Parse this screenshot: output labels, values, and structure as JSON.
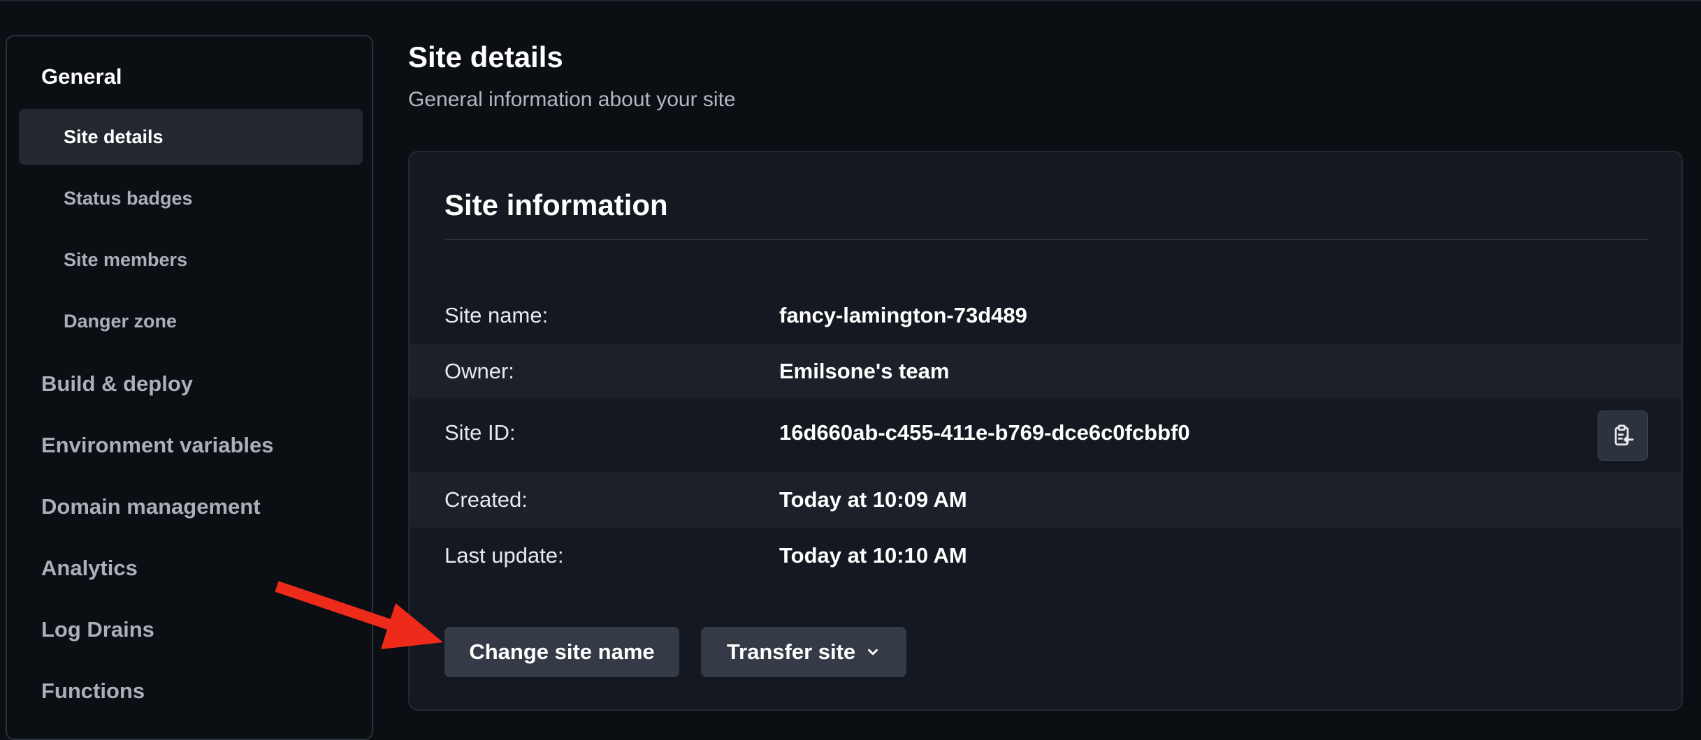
{
  "sidebar": {
    "group_title": "General",
    "sub_items": [
      {
        "label": "Site details",
        "active": true
      },
      {
        "label": "Status badges",
        "active": false
      },
      {
        "label": "Site members",
        "active": false
      },
      {
        "label": "Danger zone",
        "active": false
      }
    ],
    "main_items": [
      {
        "label": "Build & deploy"
      },
      {
        "label": "Environment variables"
      },
      {
        "label": "Domain management"
      },
      {
        "label": "Analytics"
      },
      {
        "label": "Log Drains"
      },
      {
        "label": "Functions"
      }
    ]
  },
  "header": {
    "title": "Site details",
    "subtitle": "General information about your site"
  },
  "card": {
    "title": "Site information",
    "rows": [
      {
        "label": "Site name:",
        "value": "fancy-lamington-73d489"
      },
      {
        "label": "Owner:",
        "value": "Emilsone's team"
      },
      {
        "label": "Site ID:",
        "value": "16d660ab-c455-411e-b769-dce6c0fcbbf0",
        "copy_icon": "clipboard-copy-icon"
      },
      {
        "label": "Created:",
        "value": "Today at 10:09 AM"
      },
      {
        "label": "Last update:",
        "value": "Today at 10:10 AM"
      }
    ],
    "buttons": {
      "change_name": "Change site name",
      "transfer": "Transfer site",
      "transfer_icon": "chevron-down-icon"
    }
  },
  "annotation": {
    "arrow_color": "#ee2a1b",
    "arrow_icon": "red-arrow-annotation"
  },
  "colors": {
    "background": "#0b0e13",
    "card": "#141921",
    "stripe": "#1b2029",
    "button": "#343b46",
    "text_primary": "#ffffff",
    "text_muted": "#a9b0ba"
  }
}
